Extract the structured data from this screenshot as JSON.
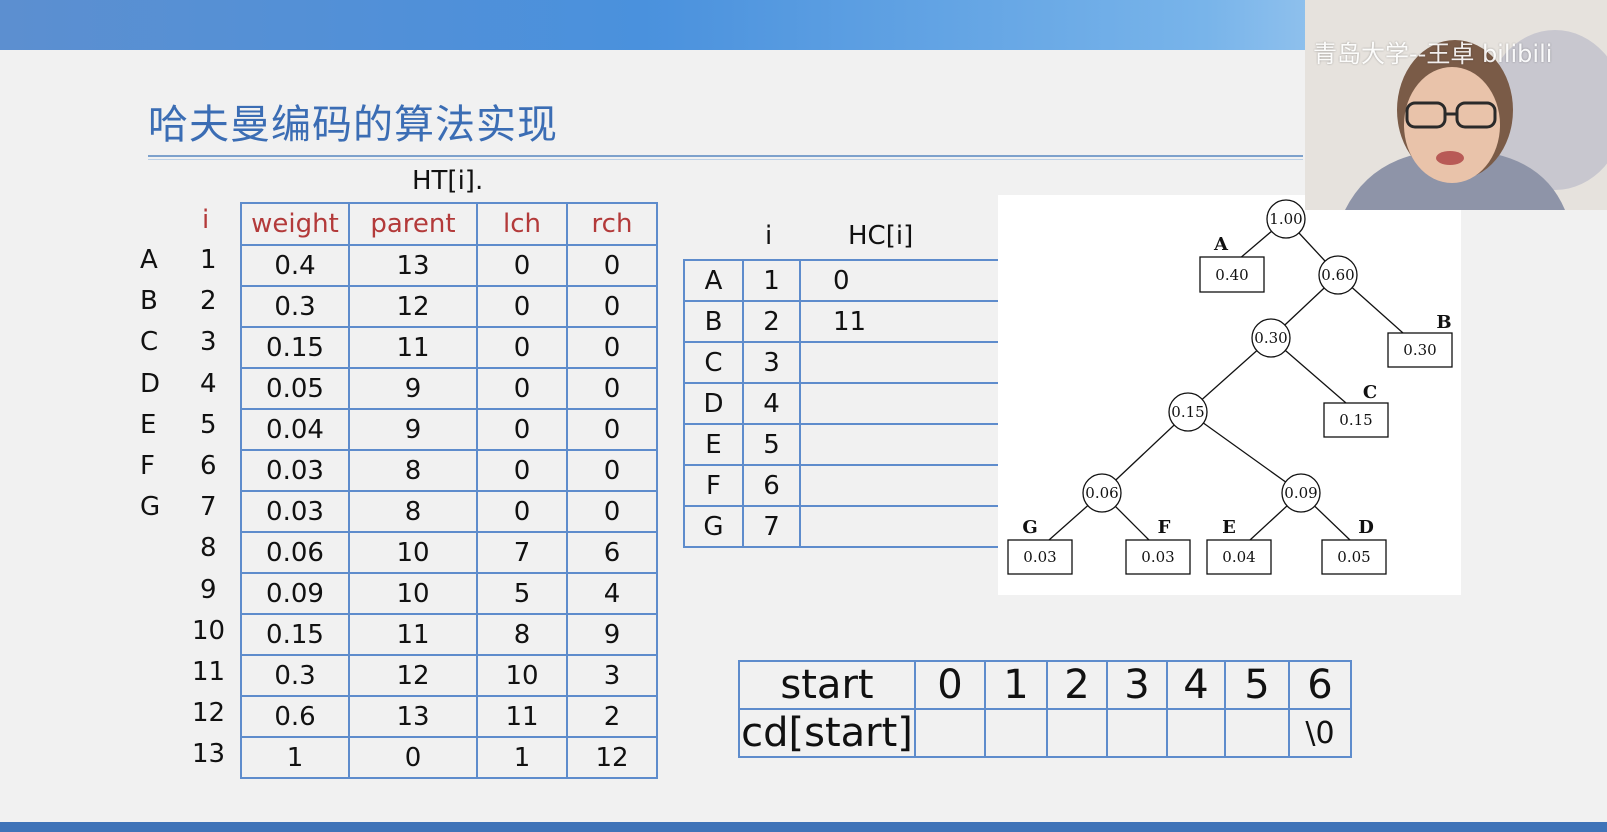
{
  "slide": {
    "title": "哈夫曼编码的算法实现"
  },
  "ht_table": {
    "caption": "HT[i].",
    "index_header": "i",
    "headers": [
      "weight",
      "parent",
      "lch",
      "rch"
    ],
    "letters": [
      "A",
      "B",
      "C",
      "D",
      "E",
      "F",
      "G"
    ],
    "rows": [
      {
        "i": "1",
        "w": "0.4",
        "p": "13",
        "l": "0",
        "r": "0"
      },
      {
        "i": "2",
        "w": "0.3",
        "p": "12",
        "l": "0",
        "r": "0"
      },
      {
        "i": "3",
        "w": "0.15",
        "p": "11",
        "l": "0",
        "r": "0"
      },
      {
        "i": "4",
        "w": "0.05",
        "p": "9",
        "l": "0",
        "r": "0"
      },
      {
        "i": "5",
        "w": "0.04",
        "p": "9",
        "l": "0",
        "r": "0"
      },
      {
        "i": "6",
        "w": "0.03",
        "p": "8",
        "l": "0",
        "r": "0"
      },
      {
        "i": "7",
        "w": "0.03",
        "p": "8",
        "l": "0",
        "r": "0"
      },
      {
        "i": "8",
        "w": "0.06",
        "p": "10",
        "l": "7",
        "r": "6"
      },
      {
        "i": "9",
        "w": "0.09",
        "p": "10",
        "l": "5",
        "r": "4"
      },
      {
        "i": "10",
        "w": "0.15",
        "p": "11",
        "l": "8",
        "r": "9"
      },
      {
        "i": "11",
        "w": "0.3",
        "p": "12",
        "l": "10",
        "r": "3"
      },
      {
        "i": "12",
        "w": "0.6",
        "p": "13",
        "l": "11",
        "r": "2"
      },
      {
        "i": "13",
        "w": "1",
        "p": "0",
        "l": "1",
        "r": "12"
      }
    ]
  },
  "hc_table": {
    "headers": [
      "i",
      "HC[i]"
    ],
    "rows": [
      {
        "letter": "A",
        "i": "1",
        "code": "0"
      },
      {
        "letter": "B",
        "i": "2",
        "code": "11"
      },
      {
        "letter": "C",
        "i": "3",
        "code": ""
      },
      {
        "letter": "D",
        "i": "4",
        "code": ""
      },
      {
        "letter": "E",
        "i": "5",
        "code": ""
      },
      {
        "letter": "F",
        "i": "6",
        "code": ""
      },
      {
        "letter": "G",
        "i": "7",
        "code": ""
      }
    ]
  },
  "tree": {
    "internal": [
      "1.00",
      "0.60",
      "0.30",
      "0.15",
      "0.06",
      "0.09"
    ],
    "leaves": [
      {
        "label": "A",
        "value": "0.40"
      },
      {
        "label": "B",
        "value": "0.30"
      },
      {
        "label": "C",
        "value": "0.15"
      },
      {
        "label": "G",
        "value": "0.03"
      },
      {
        "label": "F",
        "value": "0.03"
      },
      {
        "label": "E",
        "value": "0.04"
      },
      {
        "label": "D",
        "value": "0.05"
      }
    ]
  },
  "cd_table": {
    "row1_label": "start",
    "indices": [
      "0",
      "1",
      "2",
      "3",
      "4",
      "5",
      "6"
    ],
    "row2_label": "cd[start]",
    "values": [
      "",
      "",
      "",
      "",
      "",
      "",
      "\\0"
    ]
  },
  "webcam": {
    "watermark": "青岛大学--王卓 bilibili"
  },
  "colors": {
    "accent": "#3b6db4",
    "grid": "#5e8ccc",
    "header_red": "#b33a3a"
  }
}
